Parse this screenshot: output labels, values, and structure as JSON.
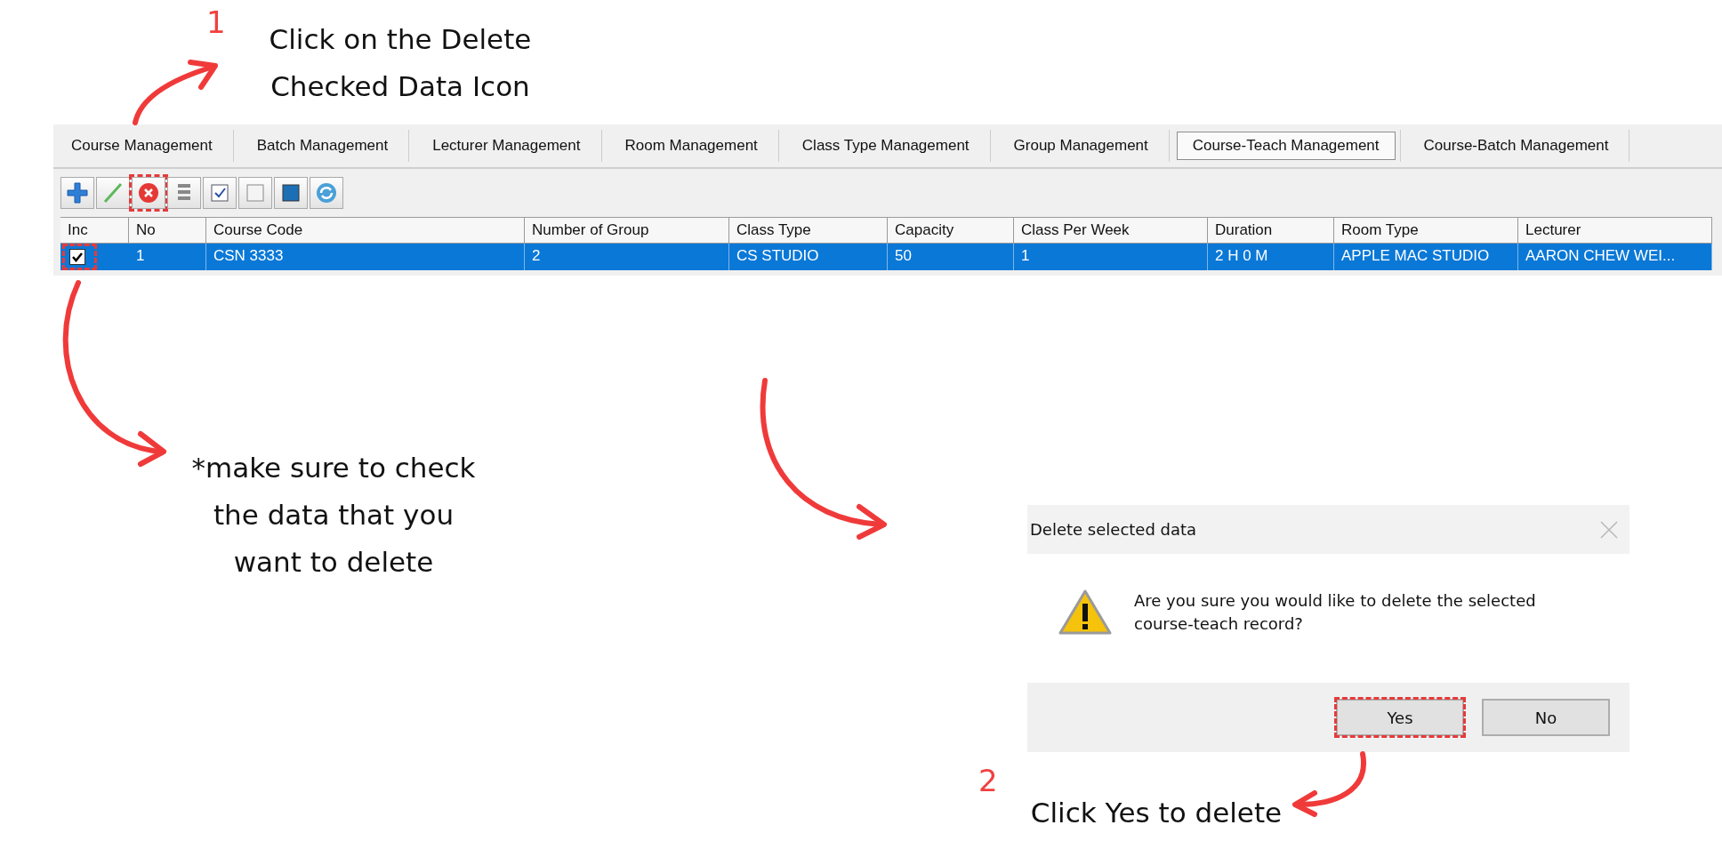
{
  "step_1": {
    "number": "1",
    "text": "Click on the Delete\nChecked Data Icon"
  },
  "app": {
    "tabs": [
      {
        "label": "Course Management",
        "selected": false
      },
      {
        "label": "Batch Management",
        "selected": false
      },
      {
        "label": "Lecturer Management",
        "selected": false
      },
      {
        "label": "Room Management",
        "selected": false
      },
      {
        "label": "Class Type Management",
        "selected": false
      },
      {
        "label": "Group Management",
        "selected": false
      },
      {
        "label": "Course-Teach Management",
        "selected": true
      },
      {
        "label": "Course-Batch Management",
        "selected": false
      }
    ],
    "toolbar": [
      {
        "kind": "add",
        "highlighted": false
      },
      {
        "kind": "edit",
        "highlighted": false
      },
      {
        "kind": "delete",
        "highlighted": true
      },
      {
        "kind": "print",
        "highlighted": false
      },
      {
        "kind": "check-all",
        "highlighted": false
      },
      {
        "kind": "uncheck-all",
        "highlighted": false
      },
      {
        "kind": "select",
        "highlighted": false
      },
      {
        "kind": "refresh",
        "highlighted": false
      }
    ],
    "table": {
      "columns": [
        "Inc",
        "No",
        "Course Code",
        "Number of Group",
        "Class Type",
        "Capacity",
        "Class Per Week",
        "Duration",
        "Room Type",
        "Lecturer"
      ],
      "rows": [
        {
          "selected": true,
          "cells": [
            {
              "kind": "checkbox",
              "checked": true,
              "highlighted": true
            },
            "1",
            "CSN 3333",
            "2",
            "CS STUDIO",
            "50",
            "1",
            "2 H 0 M",
            "APPLE MAC STUDIO",
            "AARON CHEW WEI..."
          ]
        }
      ]
    }
  },
  "note": {
    "text": "*make sure to check\nthe data that you\nwant to delete"
  },
  "dialog": {
    "title": "Delete selected data",
    "message": "Are you sure you would like to delete the selected\ncourse-teach record?",
    "buttons": [
      {
        "label": "Yes",
        "highlighted": true
      },
      {
        "label": "No",
        "highlighted": false
      }
    ]
  },
  "step_2": {
    "number": "2",
    "text": "Click Yes to delete"
  }
}
